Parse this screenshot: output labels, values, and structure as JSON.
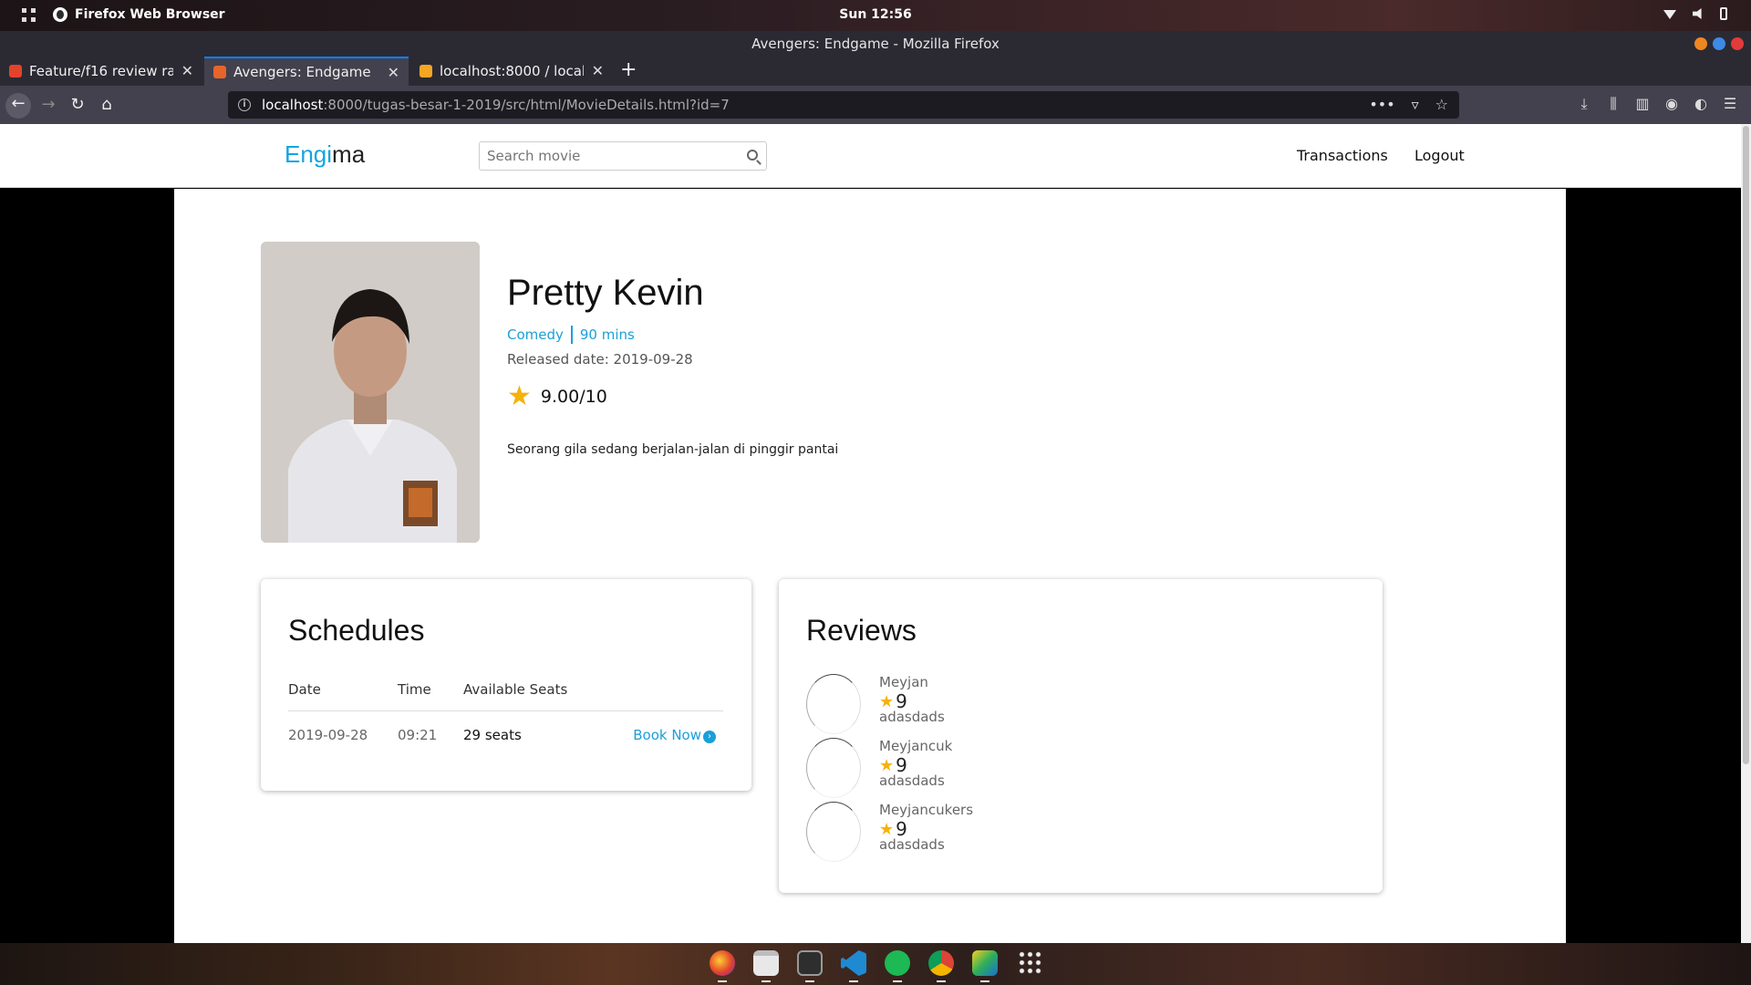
{
  "system": {
    "app_name": "Firefox Web Browser",
    "clock": "Sun 12:56"
  },
  "window": {
    "title": "Avengers: Endgame - Mozilla Firefox"
  },
  "tabs": [
    {
      "label": "Feature/f16 review rat",
      "favicon": "gitlab-icon",
      "color": "#e2432a"
    },
    {
      "label": "Avengers: Endgame",
      "favicon": "html-icon",
      "color": "#e8642c"
    },
    {
      "label": "localhost:8000 / localh",
      "favicon": "phpmyadmin-icon",
      "color": "#f5a623"
    }
  ],
  "url": {
    "host": "localhost",
    "path": ":8000/tugas-besar-1-2019/src/html/MovieDetails.html?id=7"
  },
  "site": {
    "logo_part1": "Engi",
    "logo_part2": "ma",
    "search_placeholder": "Search movie",
    "nav": {
      "transactions": "Transactions",
      "logout": "Logout"
    },
    "accent_color": "#12a5e0"
  },
  "movie": {
    "title": "Pretty Kevin",
    "genre": "Comedy",
    "duration": "90 mins",
    "released": "Released date: 2019-09-28",
    "rating": "9.00",
    "rating_suffix": "/10",
    "description": "Seorang gila sedang berjalan-jalan di pinggir pantai"
  },
  "schedules": {
    "heading": "Schedules",
    "columns": [
      "Date",
      "Time",
      "Available Seats"
    ],
    "rows": [
      {
        "date": "2019-09-28",
        "time": "09:21",
        "seats": "29 seats",
        "action": "Book Now"
      }
    ]
  },
  "reviews": {
    "heading": "Reviews",
    "items": [
      {
        "name": "Meyjan",
        "score": "9",
        "text": "adasdads"
      },
      {
        "name": "Meyjancuk",
        "score": "9",
        "text": "adasdads"
      },
      {
        "name": "Meyjancukers",
        "score": "9",
        "text": "adasdads"
      }
    ]
  },
  "dock": [
    "firefox-icon",
    "files-icon",
    "terminal-icon",
    "vscode-icon",
    "spotify-icon",
    "chrome-icon",
    "playonlinux-icon",
    "app-grid-icon"
  ]
}
